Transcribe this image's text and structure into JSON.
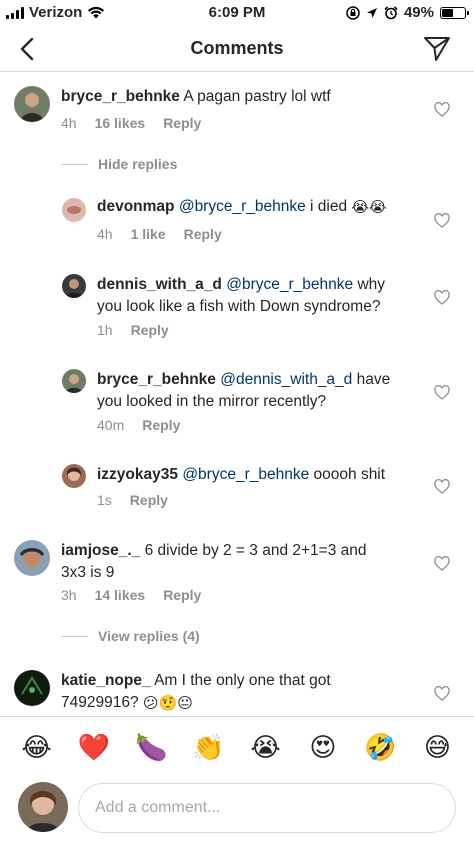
{
  "status_bar": {
    "carrier": "Verizon",
    "time": "6:09 PM",
    "battery_percent": "49%",
    "battery_level": 0.49,
    "icons": [
      "signal-bars-icon",
      "wifi-icon",
      "screen-rotation-lock-icon",
      "location-arrow-icon",
      "alarm-icon",
      "battery-icon"
    ]
  },
  "nav": {
    "title": "Comments",
    "back_icon": "chevron-left-icon",
    "share_icon": "paper-plane-icon"
  },
  "comments": [
    {
      "username": "bryce_r_behnke",
      "text": "A pagan pastry lol wtf",
      "time": "4h",
      "likes": "16 likes",
      "reply": "Reply",
      "avatar_color": "#4a5a48"
    }
  ],
  "hide_replies_label": "Hide replies",
  "replies": [
    {
      "username": "devonmap",
      "mention": "@bryce_r_behnke",
      "text": "i died",
      "emojis": "😭😭",
      "time": "4h",
      "likes": "1 like",
      "reply": "Reply",
      "avatar_color": "#d8b0a8"
    },
    {
      "username": "dennis_with_a_d",
      "mention": "@bryce_r_behnke",
      "text": "why",
      "text_line2": "you look like a fish with Down syndrome?",
      "time": "1h",
      "reply": "Reply",
      "avatar_color": "#3c3c3c"
    },
    {
      "username": "bryce_r_behnke",
      "mention": "@dennis_with_a_d",
      "text": "have",
      "text_line2": "you looked in the mirror recently?",
      "time": "40m",
      "reply": "Reply",
      "avatar_color": "#4a5a48"
    },
    {
      "username": "izzyokay35",
      "mention": "@bryce_r_behnke",
      "text": "ooooh shit",
      "time": "1s",
      "reply": "Reply",
      "avatar_color": "#8a5a48"
    }
  ],
  "comment2": {
    "username": "iamjose_._",
    "text": "6 divide by 2 = 3 and 2+1=3 and",
    "text_line2": "3x3 is 9",
    "time": "3h",
    "likes": "14 likes",
    "reply": "Reply",
    "avatar_color": "#5a7a9a"
  },
  "view_replies_label": "View replies (4)",
  "comment3": {
    "username": "katie_nope_",
    "text": "Am I the only one that got",
    "text_line2": "74929916?",
    "emojis": "😕🤨😐",
    "avatar_color": "#1a2a1a"
  },
  "emoji_bar": [
    "😂",
    "❤️",
    "🍆",
    "👏",
    "😭",
    "😍",
    "🤣",
    "😅"
  ],
  "input": {
    "placeholder": "Add a comment...",
    "value": ""
  },
  "colors": {
    "mention": "#003569",
    "meta": "#8e8e8e",
    "text": "#262626",
    "divider": "#dbdbdb"
  }
}
